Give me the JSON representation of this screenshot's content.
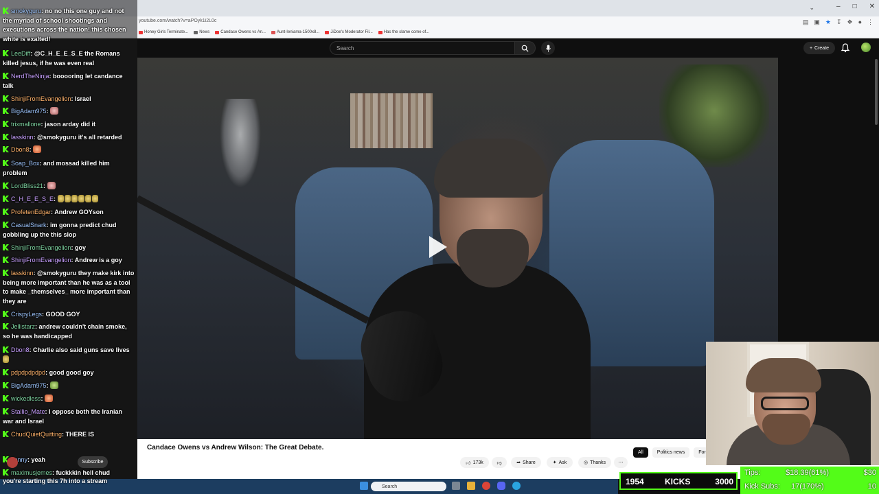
{
  "browser": {
    "url": "youtube.com/watch?v=aPOyk1i2L0c",
    "bookmarks": [
      "Candace Owens vs An...",
      "Aunt-Ieniama-1500x8...",
      "Honey Girls Terminate...",
      "News",
      "JiDoe's Moderator Fil...",
      "Has the slame come of..."
    ],
    "window_controls": [
      "–",
      "□",
      "✕"
    ]
  },
  "yt": {
    "search_placeholder": "Search",
    "create_label": "Create",
    "video_title": "Candace Owens vs Andrew Wilson: The Great Debate.",
    "subscribe_label": "Subscribe",
    "likes": "173k",
    "share_label": "Share",
    "ask_label": "Ask",
    "thanks_label": "Thanks",
    "chips": [
      "All",
      "Politics news",
      "For you"
    ]
  },
  "chat": [
    {
      "user": "smokyguru",
      "text": "no no this one guy and not the myriad of school shootings and executions across the nation! this chosen white is exalted!"
    },
    {
      "user": "LeeDiff",
      "text": "@C_H_E_E_S_E the Romans killed jesus, if he was even real"
    },
    {
      "user": "NerdTheNinja",
      "text": "booooring let candance talk"
    },
    {
      "user": "ShinjiFromEvangelion",
      "text": "Israel"
    },
    {
      "user": "BigAdam975",
      "text": ""
    },
    {
      "user": "trixmallone",
      "text": "jason arday did it"
    },
    {
      "user": "lasskinn",
      "text": "@smokyguru it's all retarded"
    },
    {
      "user": "Dbon8",
      "text": ""
    },
    {
      "user": "Soap_Box",
      "text": "and mossad killed him problem"
    },
    {
      "user": "LordBliss21",
      "text": ""
    },
    {
      "user": "C_H_E_E_S_E",
      "text": ""
    },
    {
      "user": "ProfetenEdgar",
      "text": "Andrew GOYson"
    },
    {
      "user": "CasualSnark",
      "text": "im gonna predict chud gobbling up the this slop"
    },
    {
      "user": "ShinjiFromEvangelion",
      "text": "goy"
    },
    {
      "user": "ShinjiFromEvangelion",
      "text": "Andrew is a goy"
    },
    {
      "user": "lasskinn",
      "text": "@smokyguru they make kirk into being more important than he was as a tool to make _themselves_ more important than they are"
    },
    {
      "user": "CrispyLegs",
      "text": "GOOD GOY"
    },
    {
      "user": "Jellistarz",
      "text": "andrew couldn't chain smoke, so he was handicapped"
    },
    {
      "user": "Dbon8",
      "text": "Charlie also said guns save lives"
    },
    {
      "user": "pdpdpdpdpd",
      "text": "good good goy"
    },
    {
      "user": "BigAdam975",
      "text": ""
    },
    {
      "user": "wickedless",
      "text": ""
    },
    {
      "user": "Stallio_Mate",
      "text": "I oppose both the Iranian war and Israel"
    },
    {
      "user": "ChudQuietQuitting",
      "text": "THERE IS"
    },
    {
      "user": "Jonny",
      "text": "yeah"
    },
    {
      "user": "maximusjemes",
      "text": "fuckkkin hell chud"
    }
  ],
  "chat_last": "you're starting this 7h into a stream",
  "stream": {
    "kicks_current": "1954",
    "kicks_label": "KICKS",
    "kicks_goal": "3000",
    "tips_label": "Tips:",
    "tips_value": "$18.39(61%)",
    "tips_goal": "$30",
    "subs_label": "Kick Subs:",
    "subs_value": "17(170%)",
    "subs_goal": "10"
  },
  "taskbar": {
    "search_placeholder": "Search"
  },
  "colors": {
    "kick_green": "#53fc18",
    "yt_dark": "#0f0f0f"
  }
}
